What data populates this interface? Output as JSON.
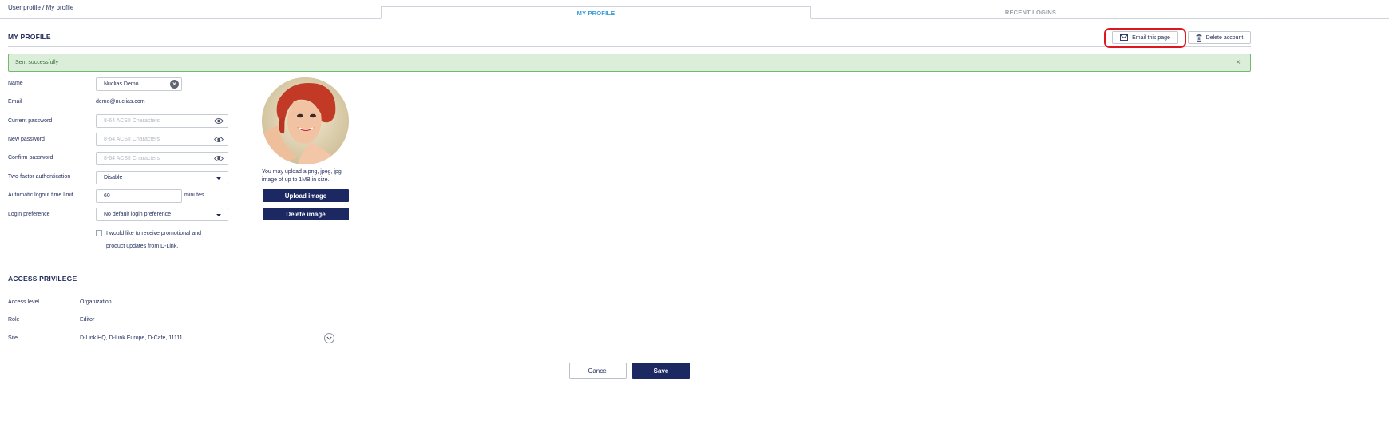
{
  "breadcrumb": {
    "parent": "User profile",
    "separator": "/",
    "current": "My profile"
  },
  "tabs": [
    {
      "label": "MY PROFILE",
      "active": true
    },
    {
      "label": "RECENT LOGINS",
      "active": false
    }
  ],
  "header": {
    "title": "MY PROFILE",
    "email_button": "Email this page",
    "delete_account_button": "Delete account"
  },
  "alert": {
    "message": "Sent successfully",
    "close": "×"
  },
  "form": {
    "name": {
      "label": "Name",
      "value": "Nuclias Demo"
    },
    "email": {
      "label": "Email",
      "value": "demo@nuclias.com"
    },
    "current_password": {
      "label": "Current password",
      "placeholder": "8-64 ACSII Characters"
    },
    "new_password": {
      "label": "New password",
      "placeholder": "8-64 ACSII Characters"
    },
    "confirm_password": {
      "label": "Confirm password",
      "placeholder": "8-64 ACSII Characters"
    },
    "two_factor": {
      "label": "Two-factor authentication",
      "value": "Disable"
    },
    "logout_limit": {
      "label": "Automatic logout time limit",
      "value": "60",
      "unit": "minutes"
    },
    "login_preference": {
      "label": "Login preference",
      "value": "No default login preference"
    },
    "promo_checkbox": {
      "checked": false,
      "line1": "I would like to receive promotional and",
      "line2": "product updates from D-Link."
    }
  },
  "avatar": {
    "upload_note": "You may upload a png, jpeg, jpg image of up to 1MB in size.",
    "upload_button": "Upload image",
    "delete_button": "Delete image"
  },
  "access": {
    "title": "ACCESS PRIVILEGE",
    "rows": [
      {
        "label": "Access level",
        "value": "Organization"
      },
      {
        "label": "Role",
        "value": "Editor"
      },
      {
        "label": "Site",
        "value": "D-Link HQ, D-Link Europe, D-Cafe, 11111"
      }
    ]
  },
  "footer": {
    "cancel_button": "Cancel",
    "save_button": "Save"
  },
  "colors": {
    "primary": "#1c2862",
    "tab_active": "#3a9bd5",
    "alert_bg": "#dbeeda",
    "alert_border": "#74b971",
    "highlight": "#e0161f"
  }
}
